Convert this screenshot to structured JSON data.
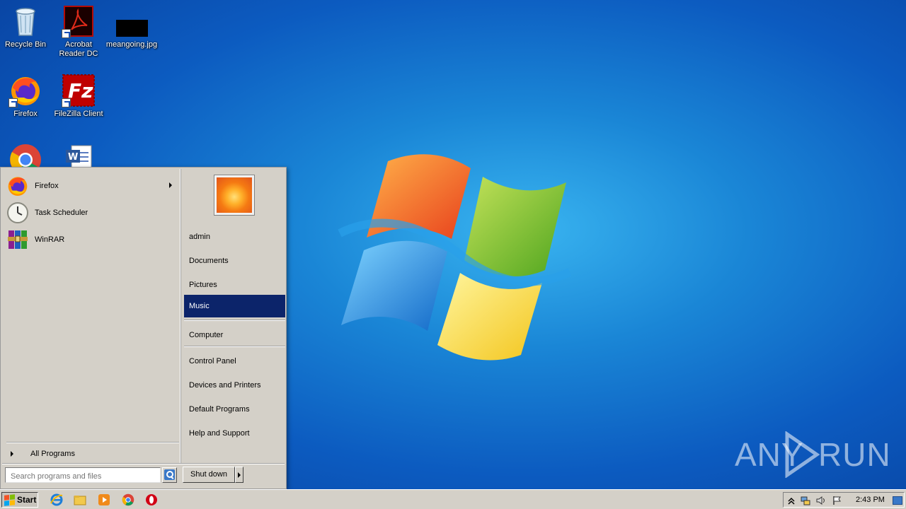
{
  "desktop": {
    "icons": [
      {
        "label": "Recycle Bin",
        "icon": "recycle-bin-icon"
      },
      {
        "label": "Acrobat Reader DC",
        "icon": "acrobat-icon"
      },
      {
        "label": "meangoing.jpg",
        "icon": "image-file-icon"
      },
      {
        "label": "Firefox",
        "icon": "firefox-icon"
      },
      {
        "label": "FileZilla Client",
        "icon": "filezilla-icon"
      },
      {
        "label": "",
        "icon": "chrome-icon"
      },
      {
        "label": "",
        "icon": "word-document-icon"
      }
    ],
    "watermark": {
      "left": "ANY",
      "right": "RUN"
    }
  },
  "start_menu": {
    "pinned": [
      {
        "label": "Firefox",
        "has_submenu": true
      },
      {
        "label": "Task Scheduler",
        "has_submenu": false
      },
      {
        "label": "WinRAR",
        "has_submenu": false
      }
    ],
    "all_programs_label": "All Programs",
    "search_placeholder": "Search programs and files",
    "right_items": [
      {
        "label": "admin"
      },
      {
        "label": "Documents"
      },
      {
        "label": "Pictures"
      },
      {
        "label": "Music",
        "active": true
      },
      {
        "label": "Computer"
      },
      {
        "label": "Control Panel"
      },
      {
        "label": "Devices and Printers"
      },
      {
        "label": "Default Programs"
      },
      {
        "label": "Help and Support"
      }
    ],
    "shutdown_label": "Shut down"
  },
  "taskbar": {
    "start_label": "Start",
    "quick_launch": [
      "internet-explorer-icon",
      "explorer-folder-icon",
      "media-player-icon",
      "chrome-icon",
      "opera-icon"
    ],
    "tray_icons": [
      "show-hidden-icons-icon",
      "network-icon",
      "volume-icon",
      "action-center-flag-icon"
    ],
    "clock": "2:43 PM"
  },
  "colors": {
    "menu_highlight": "#0c246a",
    "classic_face": "#d4d0c8"
  }
}
